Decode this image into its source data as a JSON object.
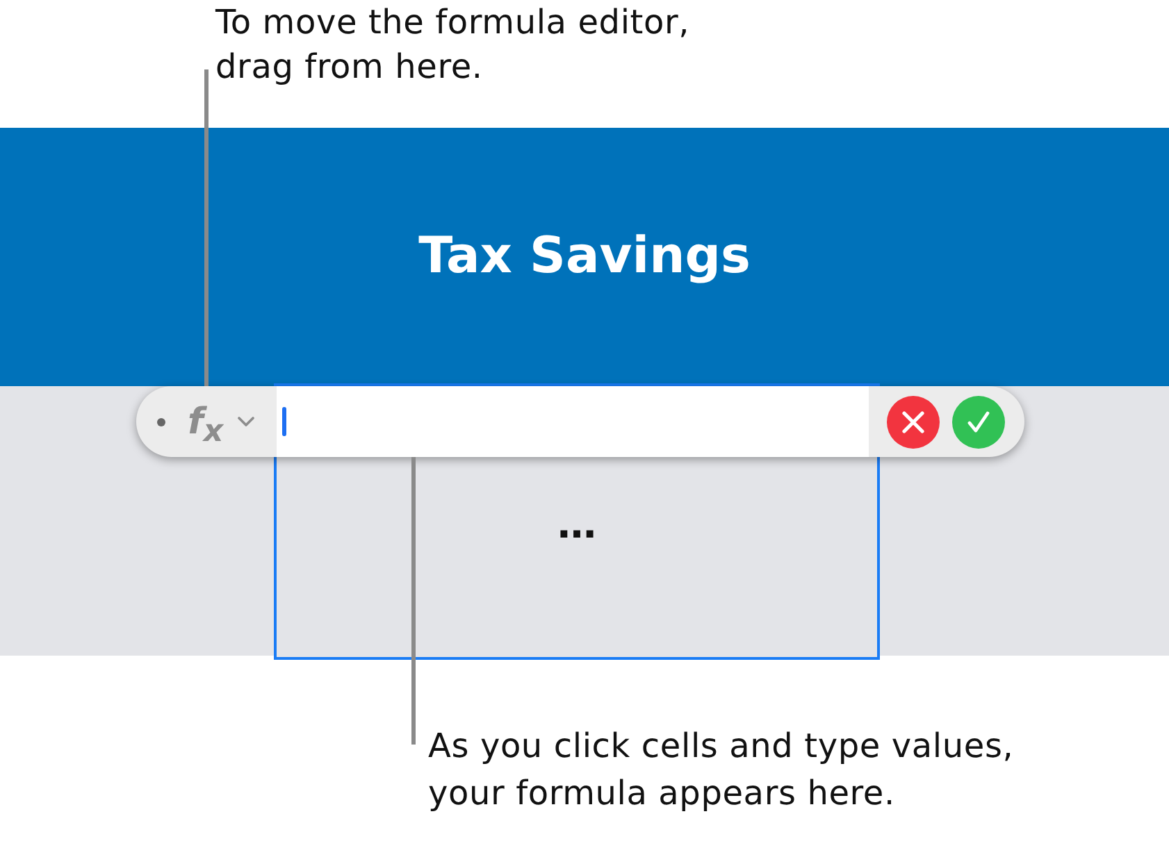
{
  "top_callout": {
    "lines": [
      "To move the formula editor,",
      "drag from here."
    ]
  },
  "table": {
    "title": "Tax Savings",
    "cell": {
      "text": "…",
      "selected": true
    }
  },
  "formula_editor": {
    "function_button": {
      "label": "f$_{x}$"
    },
    "input": {
      "focused": true
    },
    "buttons": [
      {
        "kind": "cancel"
      },
      {
        "kind": "accept"
      }
    ]
  },
  "bottom_callout": {
    "lines": [
      "As you click cells and type values,",
      "your formula appears here."
    ]
  }
}
